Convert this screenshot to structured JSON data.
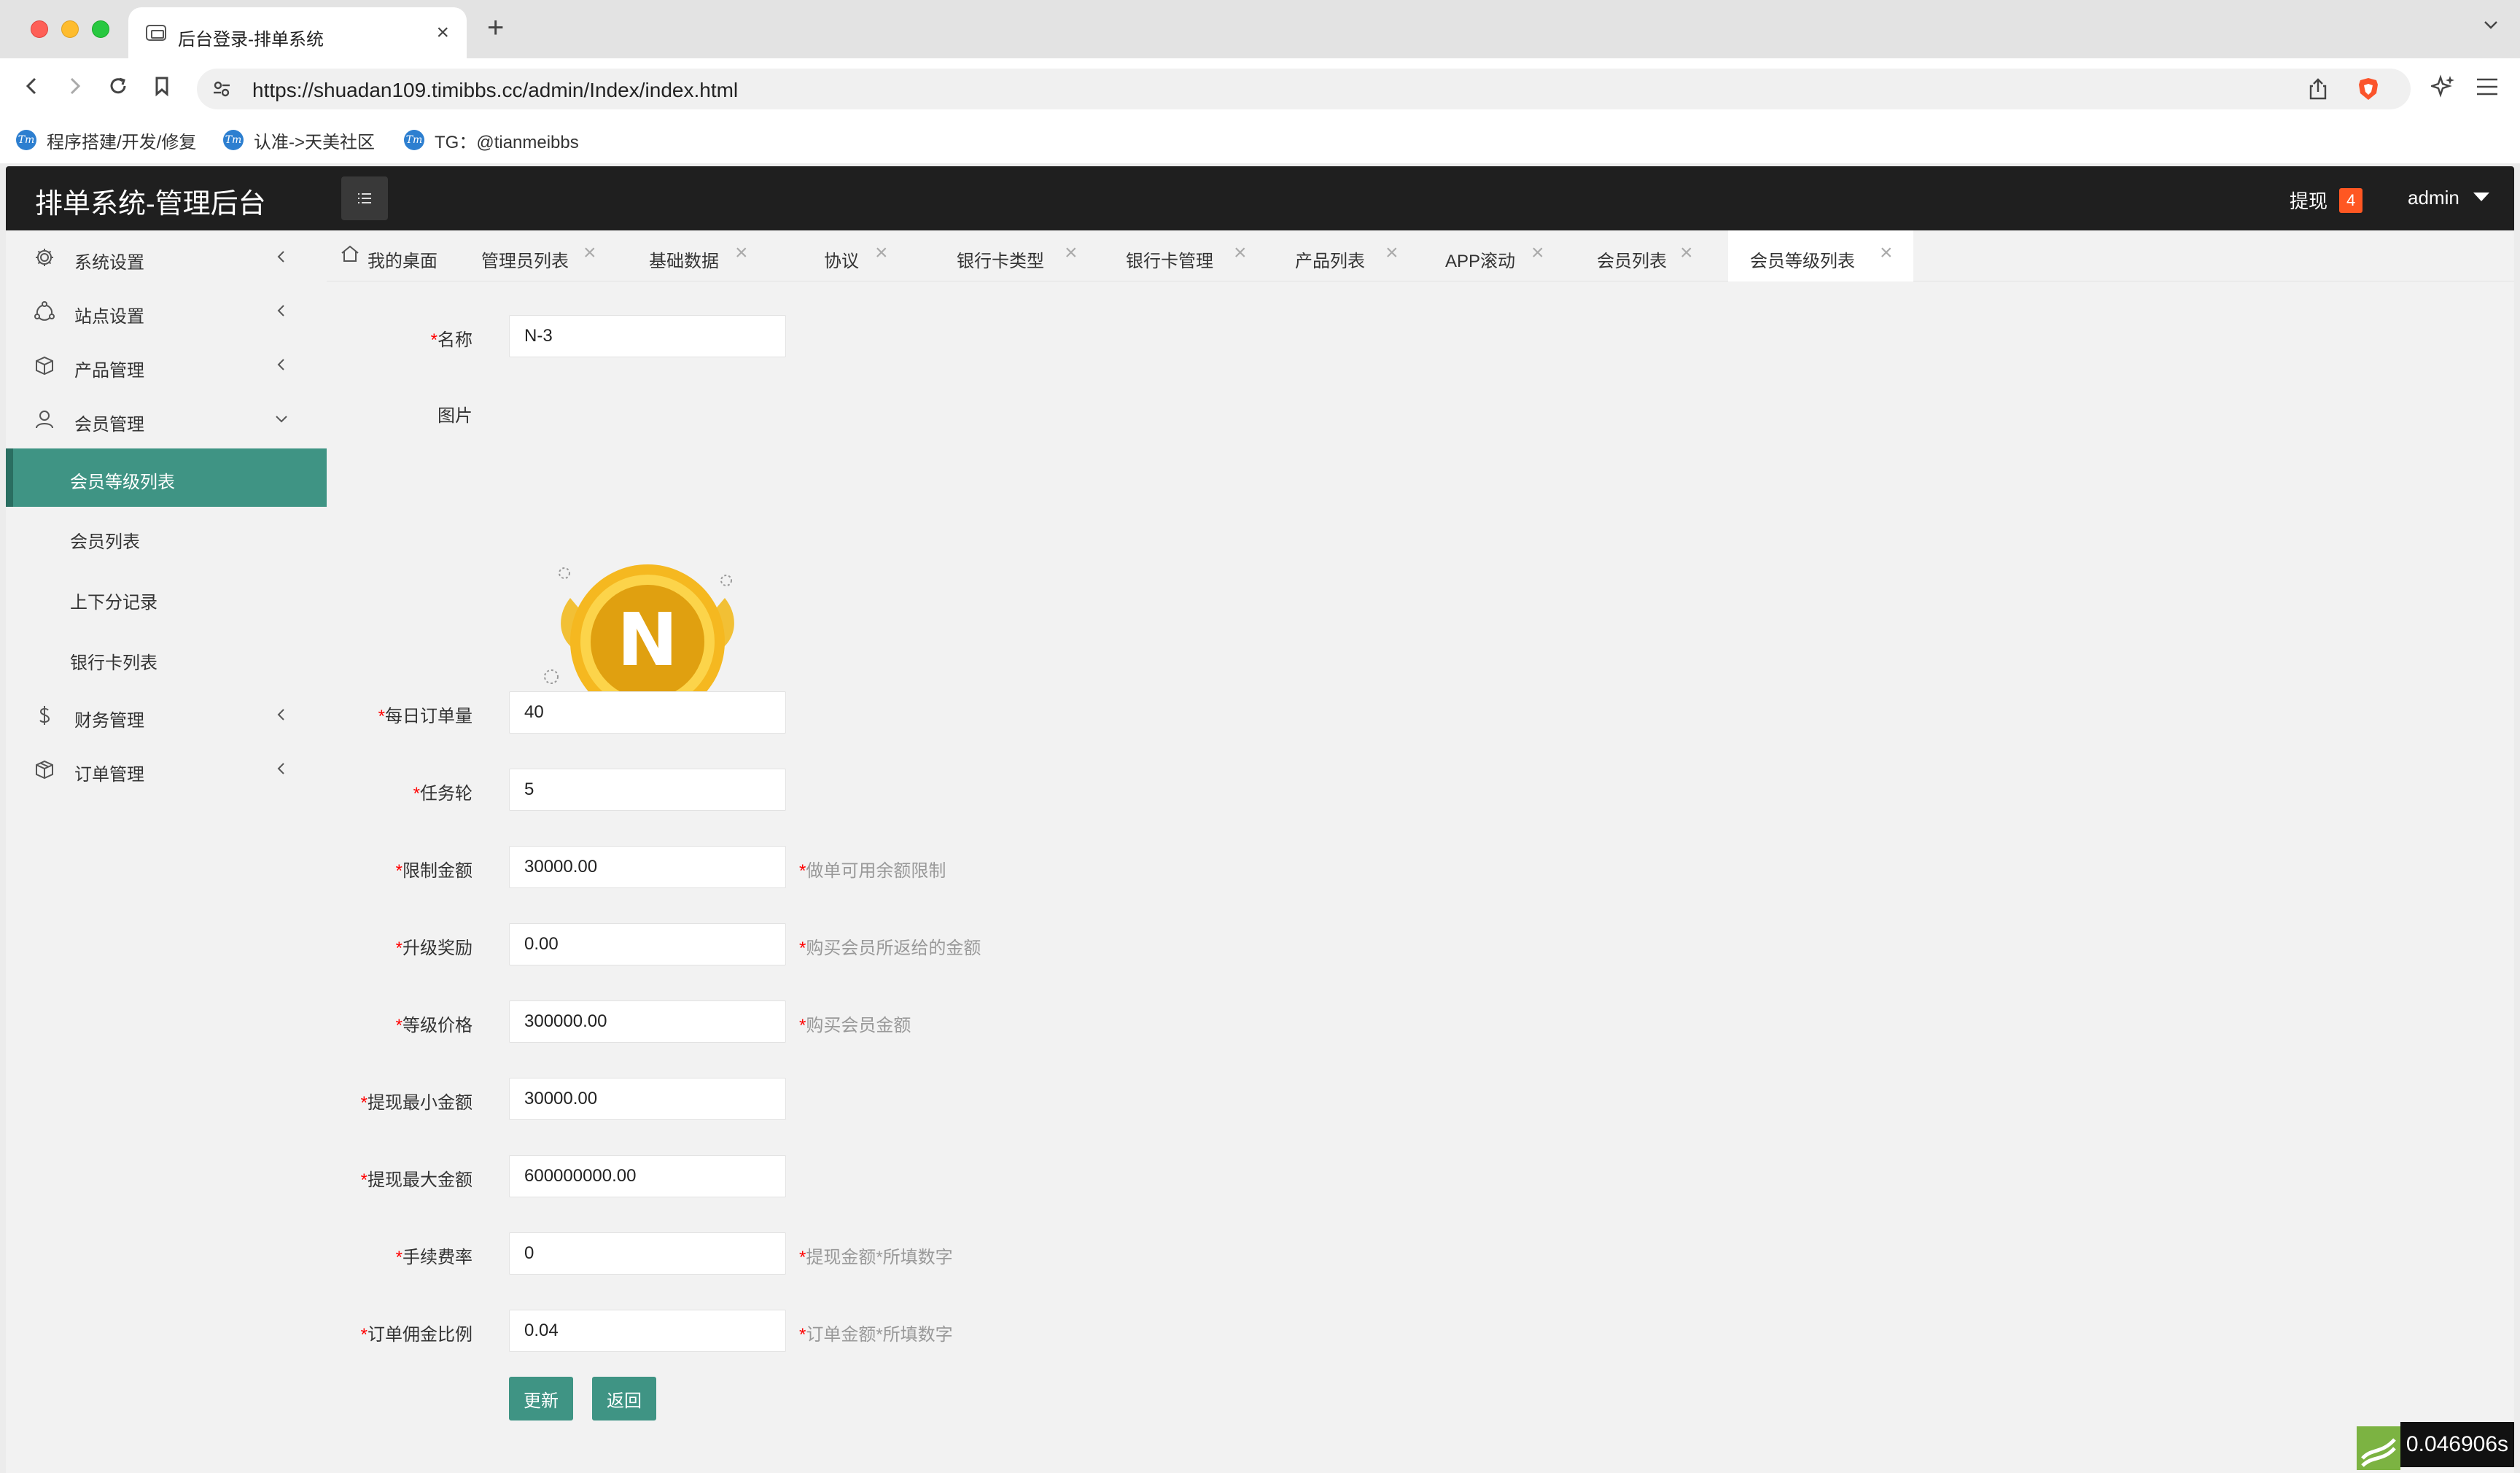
{
  "browser": {
    "tab_title": "后台登录-排单系统",
    "url": "https://shuadan109.timibbs.cc/admin/Index/index.html",
    "bookmarks": [
      {
        "label": "程序搭建/开发/修复",
        "icon": "tm"
      },
      {
        "label": "认准->天美社区",
        "icon": "tm"
      },
      {
        "label": "TG：@tianmeibbs",
        "icon": "tm"
      }
    ]
  },
  "header": {
    "logo": "排单系统-管理后台",
    "withdraw_label": "提现",
    "withdraw_count": "4",
    "user": "admin"
  },
  "sidebar": {
    "groups": [
      {
        "label": "系统设置",
        "icon": "gear-icon"
      },
      {
        "label": "站点设置",
        "icon": "site-icon"
      },
      {
        "label": "产品管理",
        "icon": "box-icon"
      },
      {
        "label": "会员管理",
        "icon": "user-icon"
      },
      {
        "label": "财务管理",
        "icon": "dollar-icon"
      },
      {
        "label": "订单管理",
        "icon": "package-icon"
      }
    ],
    "member_sub_items": [
      "会员等级列表",
      "会员列表",
      "上下分记录",
      "银行卡列表"
    ]
  },
  "tabs": [
    {
      "label": "我的桌面"
    },
    {
      "label": "管理员列表"
    },
    {
      "label": "基础数据"
    },
    {
      "label": "协议"
    },
    {
      "label": "银行卡类型"
    },
    {
      "label": "银行卡管理"
    },
    {
      "label": "产品列表"
    },
    {
      "label": "APP滚动"
    },
    {
      "label": "会员列表"
    },
    {
      "label": "会员等级列表"
    }
  ],
  "form": {
    "name": {
      "label": "名称",
      "value": "N-3"
    },
    "image": {
      "label": "图片",
      "letter": "N"
    },
    "daily_orders": {
      "label": "每日订单量",
      "value": "40"
    },
    "task_rounds": {
      "label": "任务轮",
      "value": "5"
    },
    "limit_amount": {
      "label": "限制金额",
      "value": "30000.00",
      "hint": "做单可用余额限制"
    },
    "upgrade_reward": {
      "label": "升级奖励",
      "value": "0.00",
      "hint": "购买会员所返给的金额"
    },
    "level_price": {
      "label": "等级价格",
      "value": "300000.00",
      "hint": "购买会员金额"
    },
    "min_withdraw": {
      "label": "提现最小金额",
      "value": "30000.00"
    },
    "max_withdraw": {
      "label": "提现最大金额",
      "value": "600000000.00"
    },
    "fee_rate": {
      "label": "手续费率",
      "value": "0",
      "hint": "提现金额*所填数字"
    },
    "commission_ratio": {
      "label": "订单佣金比例",
      "value": "0.04",
      "hint": "订单金额*所填数字"
    },
    "update_button": "更新",
    "back_button": "返回"
  },
  "timer": "0.046906s",
  "colors": {
    "header_bg": "#1f1f1f",
    "accent": "#3f9484",
    "badge": "#ff5722",
    "required": "#ff0000"
  }
}
